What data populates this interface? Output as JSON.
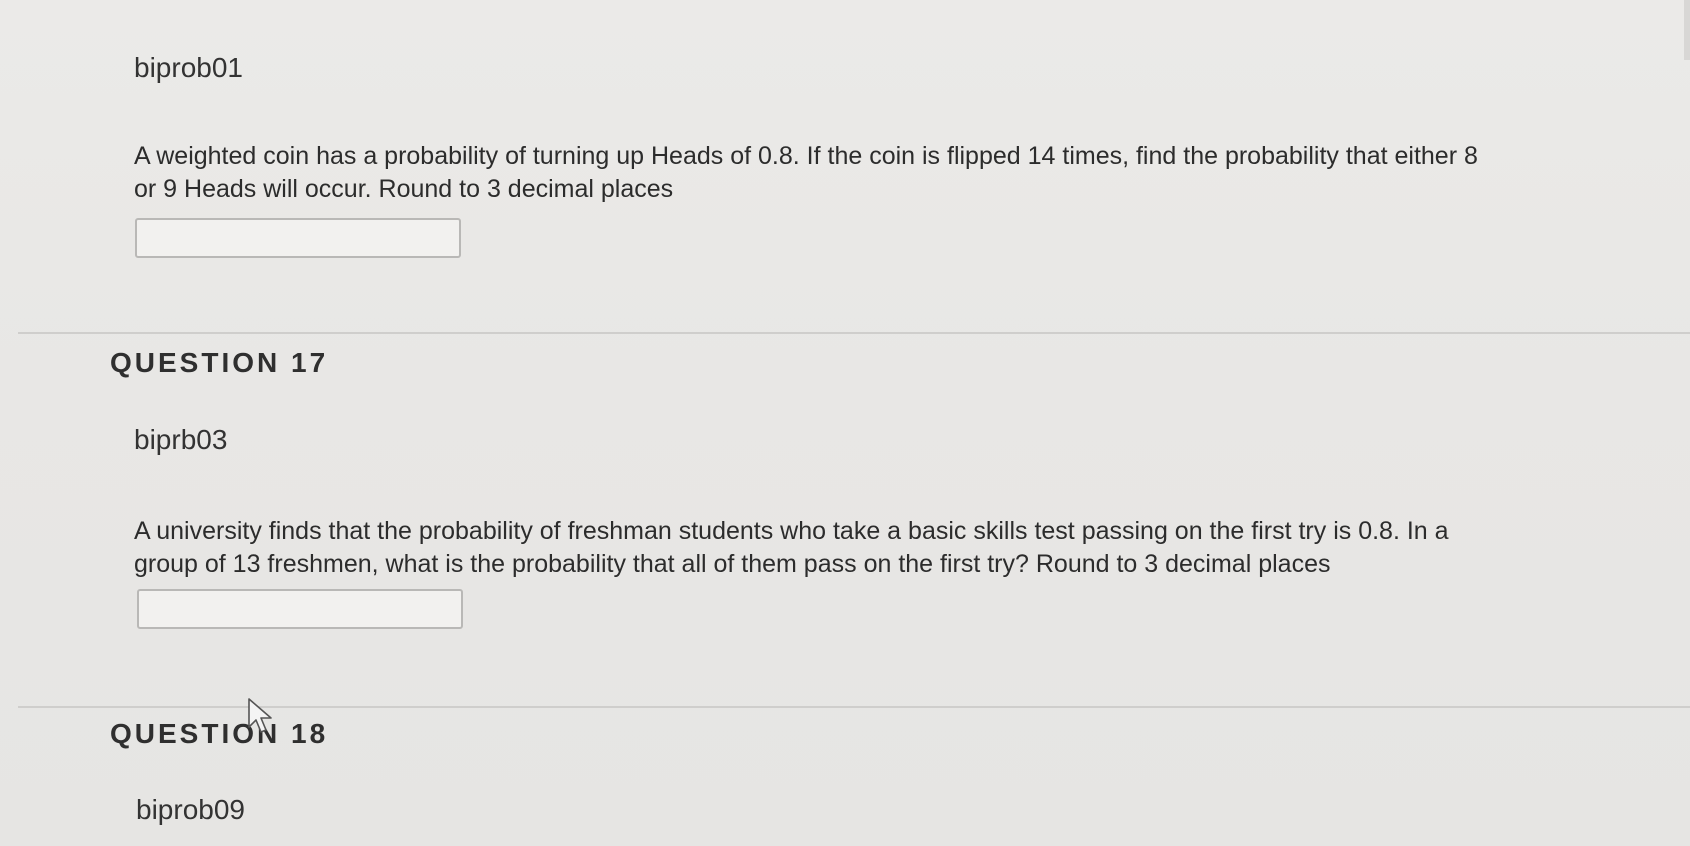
{
  "question16": {
    "id": "biprob01",
    "text_line1": "A weighted coin has a probability of turning up Heads of  0.8. If the coin is flipped 14 times, find the probability that either 8",
    "text_line2": "or 9 Heads will occur. Round to 3 decimal places",
    "answer_value": ""
  },
  "question17": {
    "heading": "QUESTION 17",
    "id": "biprb03",
    "text_line1": "A university finds that the probability of freshman students who take a basic skills test passing on the first try is 0.8. In a",
    "text_line2": "group of 13 freshmen, what is the probability that all of them pass on the first try? Round to 3 decimal places",
    "answer_value": ""
  },
  "question18": {
    "heading": "QUESTION 18",
    "id": "biprob09"
  },
  "cursor": {
    "icon": "arrow-cursor-icon"
  }
}
